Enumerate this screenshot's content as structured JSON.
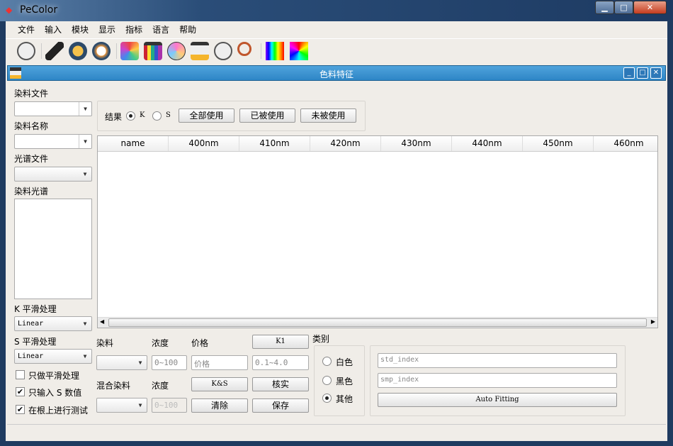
{
  "app": {
    "title": "PeColor",
    "window_buttons": {
      "minimize": "▁",
      "maximize": "□",
      "close": "✕"
    }
  },
  "menu": [
    "文件",
    "输入",
    "模块",
    "显示",
    "指标",
    "语言",
    "帮助"
  ],
  "toolbar": [
    "settings-icon",
    "keyboard-icon",
    "folder-icon",
    "light-icon",
    "color-fan-icon",
    "color-chart-icon",
    "rgb-circles-icon",
    "lab-icon",
    "palette-icon",
    "magnifier-icon",
    "spectrum-icon",
    "color-gradient-icon"
  ],
  "child": {
    "title": "色料特征"
  },
  "left": {
    "dye_file_label": "染料文件",
    "dye_name_label": "染料名称",
    "spectral_file_label": "光谱文件",
    "dye_spectrum_label": "染料光谱",
    "k_smooth_label": "K 平滑处理",
    "k_smooth_value": "Linear",
    "s_smooth_label": "S 平滑处理",
    "s_smooth_value": "Linear",
    "checks": [
      {
        "label": "只做平滑处理",
        "checked": false
      },
      {
        "label": "只输入 S 数值",
        "checked": true
      },
      {
        "label": "在根上进行测试",
        "checked": true
      }
    ]
  },
  "result": {
    "label": "结果",
    "radio_k": "K",
    "radio_s": "S",
    "selected": "K",
    "all_use": "全部使用",
    "used": "已被使用",
    "unused": "未被使用"
  },
  "table": {
    "columns": [
      "name",
      "400nm",
      "410nm",
      "420nm",
      "430nm",
      "440nm",
      "450nm",
      "460nm"
    ],
    "rows": []
  },
  "bottom": {
    "dye_label": "染料",
    "conc_label": "浓度",
    "price_label": "价格",
    "k1": "K1",
    "conc_placeholder": "0~100",
    "price_placeholder": "价格",
    "range_placeholder": "0.1~4.0",
    "mix_dye_label": "混合染料",
    "conc2_label": "浓度",
    "ks": "K&S",
    "verify": "核实",
    "conc2_placeholder": "0~100",
    "clear": "清除",
    "save": "保存"
  },
  "category": {
    "label": "类别",
    "options": [
      "白色",
      "黑色",
      "其他"
    ],
    "selected": "其他"
  },
  "fitting": {
    "std_placeholder": "std_index",
    "smp_placeholder": "smp_index",
    "auto_fitting": "Auto Fitting"
  }
}
